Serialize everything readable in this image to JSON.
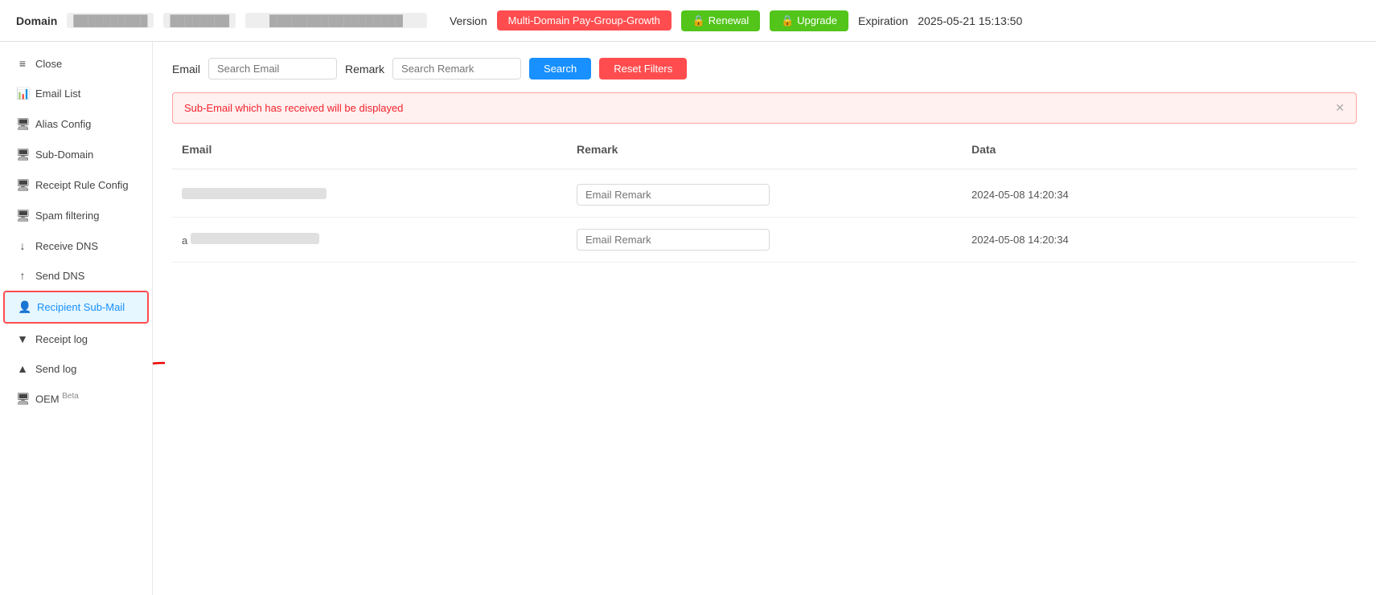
{
  "topbar": {
    "domain_label": "Domain",
    "domain_value1": "██████████",
    "domain_value2": "████████",
    "domain_value3": "██████████████████",
    "version_label": "Version",
    "version_btn": "Multi-Domain Pay-Group-Growth",
    "renewal_btn": "🔒 Renewal",
    "upgrade_btn": "🔒 Upgrade",
    "expiration_label": "Expiration",
    "expiration_value": "2025-05-21 15:13:50"
  },
  "sidebar": {
    "items": [
      {
        "id": "close",
        "label": "Close",
        "icon": "≡"
      },
      {
        "id": "email-list",
        "label": "Email List",
        "icon": "📊"
      },
      {
        "id": "alias-config",
        "label": "Alias Config",
        "icon": "🖥"
      },
      {
        "id": "sub-domain",
        "label": "Sub-Domain",
        "icon": "🖥"
      },
      {
        "id": "receipt-rule-config",
        "label": "Receipt Rule Config",
        "icon": "🖥"
      },
      {
        "id": "spam-filtering",
        "label": "Spam filtering",
        "icon": "🖥"
      },
      {
        "id": "receive-dns",
        "label": "Receive DNS",
        "icon": "↓"
      },
      {
        "id": "send-dns",
        "label": "Send DNS",
        "icon": "↑"
      },
      {
        "id": "recipient-sub-mail",
        "label": "Recipient Sub-Mail",
        "icon": "👤",
        "active": true
      },
      {
        "id": "receipt-log",
        "label": "Receipt log",
        "icon": "▼"
      },
      {
        "id": "send-log",
        "label": "Send log",
        "icon": "▲"
      },
      {
        "id": "oem",
        "label": "OEM Beta",
        "icon": "🖥"
      }
    ]
  },
  "content": {
    "filter": {
      "email_label": "Email",
      "email_placeholder": "Search Email",
      "remark_label": "Remark",
      "remark_placeholder": "Search Remark",
      "search_btn": "Search",
      "reset_btn": "Reset Filters"
    },
    "info_banner": "Sub-Email which has received will be displayed",
    "table": {
      "columns": [
        "Email",
        "Remark",
        "Data"
      ],
      "rows": [
        {
          "email_blurred": true,
          "remark_placeholder": "Email Remark",
          "date": "2024-05-08 14:20:34"
        },
        {
          "email_blurred": true,
          "email_prefix": "a",
          "remark_placeholder": "Email Remark",
          "date": "2024-05-08 14:20:34"
        }
      ]
    }
  }
}
